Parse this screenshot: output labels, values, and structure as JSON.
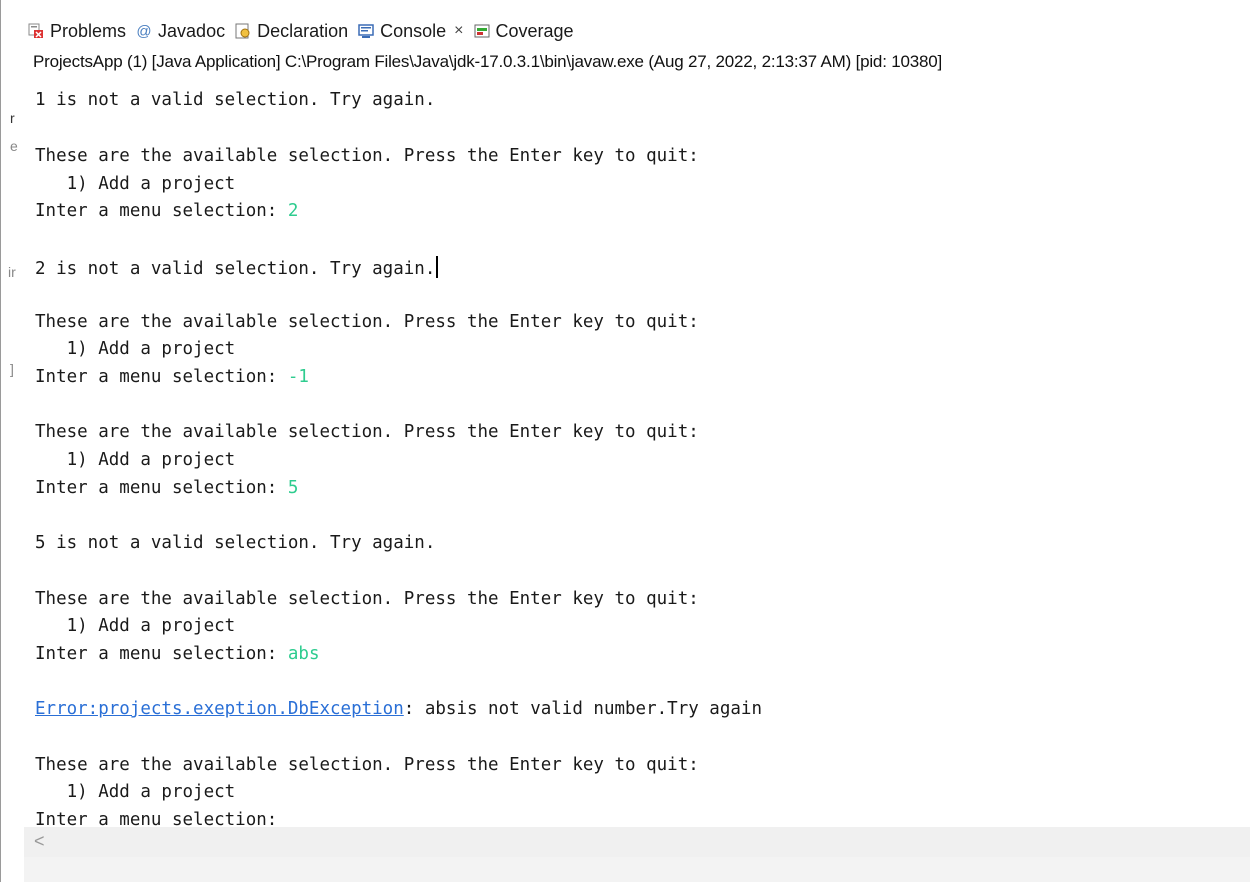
{
  "tabs": [
    {
      "label": "Problems",
      "icon": "problems-icon"
    },
    {
      "label": "Javadoc",
      "icon": "javadoc-icon"
    },
    {
      "label": "Declaration",
      "icon": "declaration-icon"
    },
    {
      "label": "Console",
      "icon": "console-icon",
      "active": true,
      "close": "×"
    },
    {
      "label": "Coverage",
      "icon": "coverage-icon"
    }
  ],
  "launch_info": "ProjectsApp (1) [Java Application] C:\\Program Files\\Java\\jdk-17.0.3.1\\bin\\javaw.exe  (Aug 27, 2022, 2:13:37 AM) [pid: 10380]",
  "left_fragments": [
    "r",
    "e",
    "ir",
    "]"
  ],
  "console": {
    "prompt_text": "These are the available selection. Press the Enter key to quit:",
    "menu_item": "   1) Add a project",
    "selection_prompt": "Inter a menu selection: ",
    "lines": [
      {
        "text": "1 is not a valid selection. Try again."
      },
      {
        "text": "These are the available selection. Press the Enter key to quit:"
      },
      {
        "text": "   1) Add a project"
      },
      {
        "text": "Inter a menu selection: ",
        "input": "2"
      },
      {
        "text": "2 is not a valid selection. Try again."
      },
      {
        "text": "These are the available selection. Press the Enter key to quit:"
      },
      {
        "text": "   1) Add a project"
      },
      {
        "text": "Inter a menu selection: ",
        "input": "-1"
      },
      {
        "text": "These are the available selection. Press the Enter key to quit:"
      },
      {
        "text": "   1) Add a project"
      },
      {
        "text": "Inter a menu selection: ",
        "input": "5"
      },
      {
        "text": "5 is not a valid selection. Try again."
      },
      {
        "text": "These are the available selection. Press the Enter key to quit:"
      },
      {
        "text": "   1) Add a project"
      },
      {
        "text": "Inter a menu selection: ",
        "input": "abs"
      },
      {
        "link": "Error:projects.exeption.DbException",
        "text": ": absis not valid number.Try again"
      },
      {
        "text": "These are the available selection. Press the Enter key to quit:"
      },
      {
        "text": "   1) Add a project"
      },
      {
        "text": "Inter a menu selection:"
      }
    ]
  },
  "scroll_left_arrow": "<",
  "colors": {
    "input": "#2ecc8f",
    "link": "#2a6fd6"
  }
}
